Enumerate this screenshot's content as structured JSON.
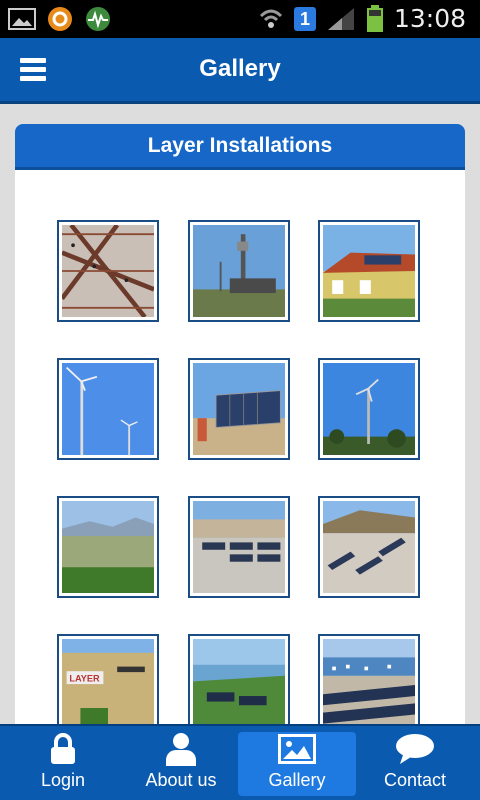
{
  "status_bar": {
    "time": "13:08",
    "notification_count": "1",
    "icons": [
      "picture-icon",
      "orange-app-icon",
      "activity-icon",
      "wifi-icon",
      "signal-icon",
      "battery-icon"
    ]
  },
  "header": {
    "title": "Gallery",
    "menu_icon": "hamburger-icon"
  },
  "section": {
    "title": "Layer Installations"
  },
  "gallery": {
    "thumbnails": [
      {
        "name": "thumb-pergola-panels"
      },
      {
        "name": "thumb-antenna-tower"
      },
      {
        "name": "thumb-house-roof"
      },
      {
        "name": "thumb-wind-turbine-1"
      },
      {
        "name": "thumb-solar-frame"
      },
      {
        "name": "thumb-wind-turbine-2"
      },
      {
        "name": "thumb-valley-view"
      },
      {
        "name": "thumb-rooftop-array-1"
      },
      {
        "name": "thumb-rooftop-array-2"
      },
      {
        "name": "thumb-layer-building"
      },
      {
        "name": "thumb-coastal-array"
      },
      {
        "name": "thumb-harbor-array"
      }
    ]
  },
  "bottom_nav": {
    "items": [
      {
        "label": "Login",
        "icon": "lock-icon"
      },
      {
        "label": "About us",
        "icon": "user-icon"
      },
      {
        "label": "Gallery",
        "icon": "image-icon",
        "active": true
      },
      {
        "label": "Contact",
        "icon": "chat-bubble-icon"
      }
    ]
  },
  "thumb_logo_text": "LAYER",
  "colors": {
    "primary": "#0a5bb0",
    "header_panel": "#1667c7",
    "active_tab": "#1e7ae0",
    "thumb_border": "#1a4d85"
  }
}
